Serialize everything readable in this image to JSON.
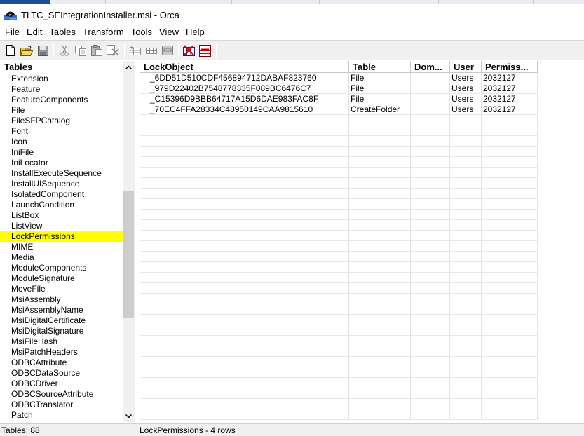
{
  "window": {
    "title": "TLTC_SEIntegrationInstaller.msi - Orca"
  },
  "menu": [
    "File",
    "Edit",
    "Tables",
    "Transform",
    "Tools",
    "View",
    "Help"
  ],
  "toolbar": {
    "buttons": [
      "new-icon",
      "open-icon",
      "save-icon",
      "cut-icon",
      "copy-icon",
      "paste-icon",
      "delete-icon",
      "add-table-icon",
      "add-row-icon",
      "find-icon",
      "validate-icon",
      "transform-icon"
    ]
  },
  "tables_pane": {
    "header": "Tables",
    "items": [
      "Extension",
      "Feature",
      "FeatureComponents",
      "File",
      "FileSFPCatalog",
      "Font",
      "Icon",
      "IniFile",
      "IniLocator",
      "InstallExecuteSequence",
      "InstallUISequence",
      "IsolatedComponent",
      "LaunchCondition",
      "ListBox",
      "ListView",
      "LockPermissions",
      "MIME",
      "Media",
      "ModuleComponents",
      "ModuleSignature",
      "MoveFile",
      "MsiAssembly",
      "MsiAssemblyName",
      "MsiDigitalCertificate",
      "MsiDigitalSignature",
      "MsiFileHash",
      "MsiPatchHeaders",
      "ODBCAttribute",
      "ODBCDataSource",
      "ODBCDriver",
      "ODBCSourceAttribute",
      "ODBCTranslator",
      "Patch"
    ],
    "selected": "LockPermissions"
  },
  "grid": {
    "columns": [
      "LockObject",
      "Table",
      "Dom...",
      "User",
      "Permiss..."
    ],
    "rows": [
      [
        "_6DD51D510CDF456894712DABAF823760",
        "File",
        "",
        "Users",
        "2032127"
      ],
      [
        "_979D22402B7548778335F089BC6476C7",
        "File",
        "",
        "Users",
        "2032127"
      ],
      [
        "_C15396D9BBB64717A15D6DAE983FAC8F",
        "File",
        "",
        "Users",
        "2032127"
      ],
      [
        "_70EC4FFA28334C48950149CAA9815610",
        "CreateFolder",
        "",
        "Users",
        "2032127"
      ]
    ]
  },
  "status": {
    "tables_count": "Tables: 88",
    "table_info": "LockPermissions - 4 rows"
  },
  "colors": {
    "selection": "#ffff00",
    "chrome": "#f0f0f0"
  }
}
